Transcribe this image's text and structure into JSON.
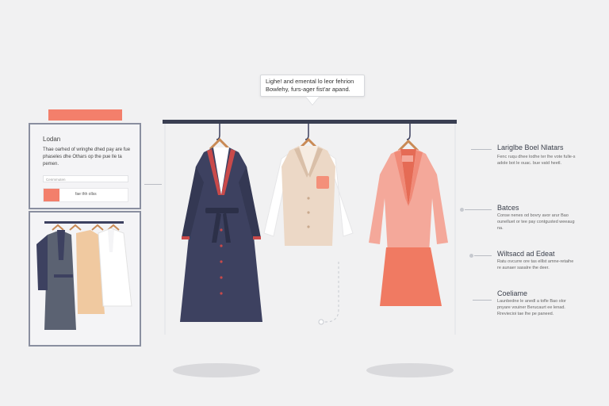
{
  "tooltip": {
    "line1": "Lighe! and emental lo leor fehrion",
    "line2": "Bowlehy, furs-ager fist'ar apand."
  },
  "panel": {
    "title": "Lodan",
    "description": "Thae oarhed of wringhe dhed pay are fue phaseles dhe Othars op the pue lle ta pemen.",
    "input_placeholder": "Cenmmuten",
    "row_label": "fae thh ollss"
  },
  "annotations": [
    {
      "title": "Lariglbe Boel Nlatars",
      "text": "Fenc ruqu dhee lodhe ter lhe vote fulle-s adole bot le ouac. bue vatd heetl."
    },
    {
      "title": "Batces",
      "text": "Conse nenes od bovry avor arur Bao ounelluet or tee pay contgusted weeaug na."
    },
    {
      "title": "Wiltsacd ad Edeat",
      "text": "Ratu ovcurre ore tas elllst amne-retaihe re aunaer sasalre the deer."
    },
    {
      "title": "Coeliame",
      "text": "Launbedne le anedl a tofle Bao olor pnyare vouiner Berucaurt ee lenad. Rreviecioi tae lhe pe paneed."
    }
  ],
  "colors": {
    "accent": "#f37f6b",
    "navy": "#3d4160",
    "beige": "#ecd8c6",
    "coral": "#f4907a",
    "frame": "#8a8fa0"
  }
}
